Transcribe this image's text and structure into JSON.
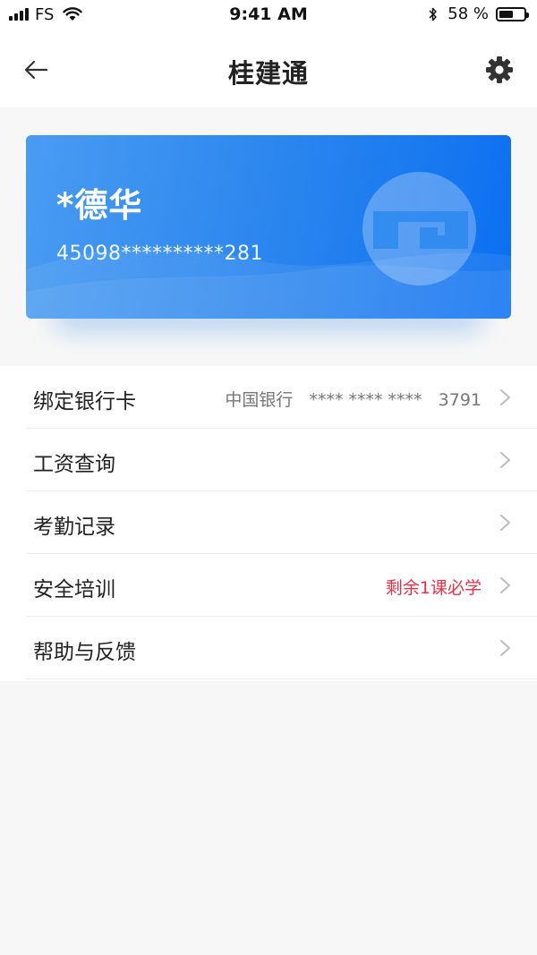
{
  "status_bar": {
    "carrier": "FS",
    "time": "9:41 AM",
    "battery_percent": "58 %",
    "battery_level": 0.58
  },
  "nav": {
    "title": "桂建通",
    "back_icon": "arrow-left-icon",
    "settings_icon": "gear-icon"
  },
  "card": {
    "name": "*德华",
    "number": "45098**********281",
    "logo_icon": "guijiantong-logo-icon",
    "colors": {
      "start": "#4a9cf2",
      "end": "#0b6ff0"
    }
  },
  "menu": {
    "items": [
      {
        "label": "绑定银行卡",
        "value": "中国银行   **** **** ****   3791"
      },
      {
        "label": "工资查询",
        "value": ""
      },
      {
        "label": "考勤记录",
        "value": ""
      },
      {
        "label": "安全培训",
        "value": "剩余1课必学"
      },
      {
        "label": "帮助与反馈",
        "value": ""
      }
    ],
    "alert_color": "#e8304a"
  }
}
